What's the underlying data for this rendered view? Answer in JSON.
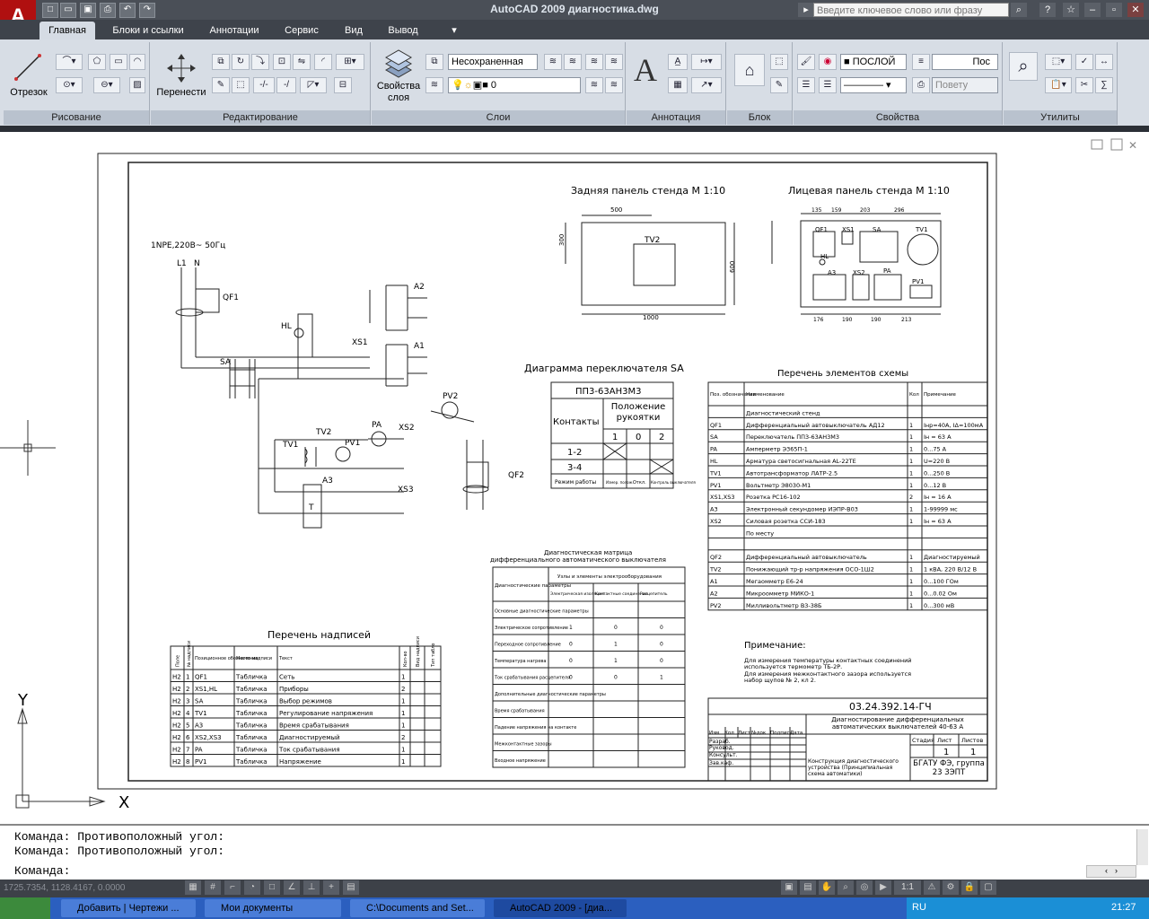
{
  "window": {
    "title": "AutoCAD 2009 диагностика.dwg",
    "logo": "A",
    "search_placeholder": "Введите ключевое слово или фразу",
    "quick_access": [
      "new",
      "open",
      "save",
      "print",
      "undo",
      "redo"
    ]
  },
  "tabs": [
    "Главная",
    "Блоки и ссылки",
    "Аннотации",
    "Сервис",
    "Вид",
    "Вывод"
  ],
  "ribbon": {
    "panels": {
      "draw": "Рисование",
      "modify": "Редактирование",
      "layers": "Слои",
      "annotation": "Аннотация",
      "block": "Блок",
      "properties": "Свойства",
      "utilities": "Утилиты"
    },
    "buttons": {
      "line": "Отрезок",
      "move": "Перенести",
      "layer_props_1": "Свойства",
      "layer_props_2": "слоя"
    },
    "layer_state": "Несохраненная",
    "layer_current": "0",
    "color": "ПОСЛОЙ",
    "linetype": "Пос",
    "plotstyle": "Повету"
  },
  "command": {
    "lines": [
      "Команда: Противоположный угол:",
      "Команда: Противоположный угол:"
    ],
    "prompt": "Команда:"
  },
  "status": {
    "coords": "1725.7354, 1128.4167, 0.0000",
    "scale": "1:1"
  },
  "taskbar": {
    "items": [
      "Добавить | Чертежи ...",
      "Мои документы",
      "C:\\Documents and Set...",
      "AutoCAD 2009 - [диа..."
    ],
    "lang": "RU",
    "time": "21:27"
  },
  "drawing": {
    "supply": "1NPE,220В~ 50Гц",
    "labels": {
      "L1": "L1",
      "N": "N",
      "QF1": "QF1",
      "HL": "HL",
      "XS1": "XS1",
      "A1": "A1",
      "A2": "A2",
      "SA": "SA",
      "PA": "PA",
      "XS2": "XS2",
      "PV2": "PV2",
      "TV1": "TV1",
      "TV2": "TV2",
      "PV1": "PV1",
      "A3": "A3",
      "XS3": "XS3",
      "QF2": "QF2",
      "T": "T"
    },
    "back_panel": {
      "title": "Задняя панель стенда М 1:10",
      "label": "TV2",
      "dim_w": "500",
      "dim_h": "300",
      "dim_total": "1000",
      "dim_side": "600"
    },
    "front_panel": {
      "title": "Лицевая панель стенда М 1:10",
      "labels": [
        "QF1",
        "XS1",
        "SA",
        "TV1",
        "HL",
        "A3",
        "XS2",
        "PA",
        "PV1"
      ],
      "dims_top": [
        "135",
        "159",
        "203",
        "296"
      ],
      "dims_bottom": [
        "176",
        "190",
        "190",
        "213"
      ]
    },
    "switch_diagram": {
      "title": "Диаграмма переключателя SA",
      "model": "ПП3-63АН3М3",
      "col1": "Контакты",
      "col2": "Положение рукоятки",
      "positions": [
        "1",
        "0",
        "2"
      ],
      "rows": [
        "1-2",
        "3-4"
      ],
      "footer": "Режим работы",
      "modes": [
        "Измер. полож.",
        "Откл.",
        "Контроль выключателя"
      ]
    },
    "elements": {
      "title": "Перечень элементов схемы",
      "headers": [
        "Поз. обозначение",
        "Наименование",
        "Кол",
        "Примечание"
      ],
      "rows": [
        [
          "",
          "Диагностический стенд",
          "",
          ""
        ],
        [
          "QF1",
          "Дифференциальный автовыключатель АД12",
          "1",
          "Iнр=40А, IΔ=100мА"
        ],
        [
          "SA",
          "Переключатель ПП3-63АН3М3",
          "1",
          "Iн = 63 А"
        ],
        [
          "PA",
          "Амперметр Э365П-1",
          "1",
          "0...75 А"
        ],
        [
          "HL",
          "Арматура светосигнальная AL-22TE",
          "1",
          "U=220 В"
        ],
        [
          "TV1",
          "Автотрансформатор ЛАТР-2.5",
          "1",
          "0...250 В"
        ],
        [
          "PV1",
          "Вольтметр Э8030-М1",
          "1",
          "0...12 В"
        ],
        [
          "XS1,XS3",
          "Розетка РС16-102",
          "2",
          "Iн = 16 А"
        ],
        [
          "A3",
          "Электронный секундомер ИЭПР-В03",
          "1",
          "1-99999 мс"
        ],
        [
          "XS2",
          "Силовая розетка ССИ-183",
          "1",
          "Iн = 63 А"
        ],
        [
          "",
          "По месту",
          "",
          ""
        ],
        [
          "",
          "",
          "",
          ""
        ],
        [
          "QF2",
          "Дифференциальный автовыключатель",
          "1",
          "Диагностируемый"
        ],
        [
          "TV2",
          "Понижающий тр-р напряжения ОСО-1Ш2",
          "1",
          "1 кВА, 220 В/12 В"
        ],
        [
          "A1",
          "Мегаомметр Е6-24",
          "1",
          "0...100 ГОм"
        ],
        [
          "A2",
          "Микроомметр МИКО-1",
          "1",
          "0...0.02 Ом"
        ],
        [
          "PV2",
          "Милливольтметр В3-38Б",
          "1",
          "0...300 мВ"
        ]
      ]
    },
    "matrix": {
      "title1": "Диагностическая матрица",
      "title2": "дифференциального автоматического выключателя",
      "corner": "Диагностические параметры",
      "group": "Узлы и элементы электрооборудования",
      "cols": [
        "Электрическая изоляция",
        "Контактные соединения",
        "Расцепитель"
      ],
      "rows": [
        [
          "Основные диагностические параметры",
          "",
          "",
          ""
        ],
        [
          "Электрическое сопротивление",
          "1",
          "0",
          "0"
        ],
        [
          "Переходное сопротивление",
          "0",
          "1",
          "0"
        ],
        [
          "Температура нагрева",
          "0",
          "1",
          "0"
        ],
        [
          "Ток срабатывания расцепителя",
          "0",
          "0",
          "1"
        ],
        [
          "Дополнительные диагностические параметры",
          "",
          "",
          ""
        ],
        [
          "Время срабатывания",
          "",
          "",
          ""
        ],
        [
          "Падение напряжения на контакте",
          "",
          "",
          ""
        ],
        [
          "Межконтактные зазоры",
          "",
          "",
          ""
        ],
        [
          "Входное напряжение",
          "",
          "",
          ""
        ]
      ]
    },
    "inscriptions": {
      "title": "Перечень надписей",
      "headers": [
        "Поле",
        "№ надписи",
        "Позиционное обозначение",
        "Место надписи",
        "Текст",
        "Кол-во",
        "Вид надписи",
        "Тип табло"
      ],
      "rows": [
        [
          "H2",
          "1",
          "QF1",
          "Табличка",
          "Сеть",
          "1"
        ],
        [
          "H2",
          "2",
          "XS1,HL",
          "Табличка",
          "Приборы",
          "2"
        ],
        [
          "H2",
          "3",
          "SA",
          "Табличка",
          "Выбор режимов",
          "1"
        ],
        [
          "H2",
          "4",
          "TV1",
          "Табличка",
          "Регулирование напряжения",
          "1"
        ],
        [
          "H2",
          "5",
          "A3",
          "Табличка",
          "Время срабатывания",
          "1"
        ],
        [
          "H2",
          "6",
          "XS2,XS3",
          "Табличка",
          "Диагностируемый",
          "2"
        ],
        [
          "H2",
          "7",
          "PA",
          "Табличка",
          "Ток срабатывания",
          "1"
        ],
        [
          "H2",
          "8",
          "PV1",
          "Табличка",
          "Напряжение",
          "1"
        ]
      ]
    },
    "note": {
      "title": "Примечание:",
      "lines": [
        "Для измерения температуры контактных соединений",
        "используется термометр ТБ-2Р.",
        "Для измерения межконтактного зазора используется",
        "набор щупов № 2, кл 2."
      ]
    },
    "stamp": {
      "code": "03.24.392.14-ГЧ",
      "title": "Диагностирование дифференциальных автоматических выключателей 40-63 А",
      "cols": [
        "Стадия",
        "Лист",
        "Листов"
      ],
      "sheet": "1",
      "sheets": "1",
      "subject": "Конструкция диагностического устройства (Принципиальная схема автоматики)",
      "org": "БГАТУ ФЭ, группа 23 ЗЭПТ",
      "roles": [
        "Разраб.",
        "Руковод.",
        "Консульт.",
        "Зав.каф."
      ],
      "head": [
        "Изм",
        "Кол",
        "Лист",
        "№док",
        "Подпись",
        "Дата"
      ]
    },
    "ucs": {
      "x": "X",
      "y": "Y"
    }
  }
}
